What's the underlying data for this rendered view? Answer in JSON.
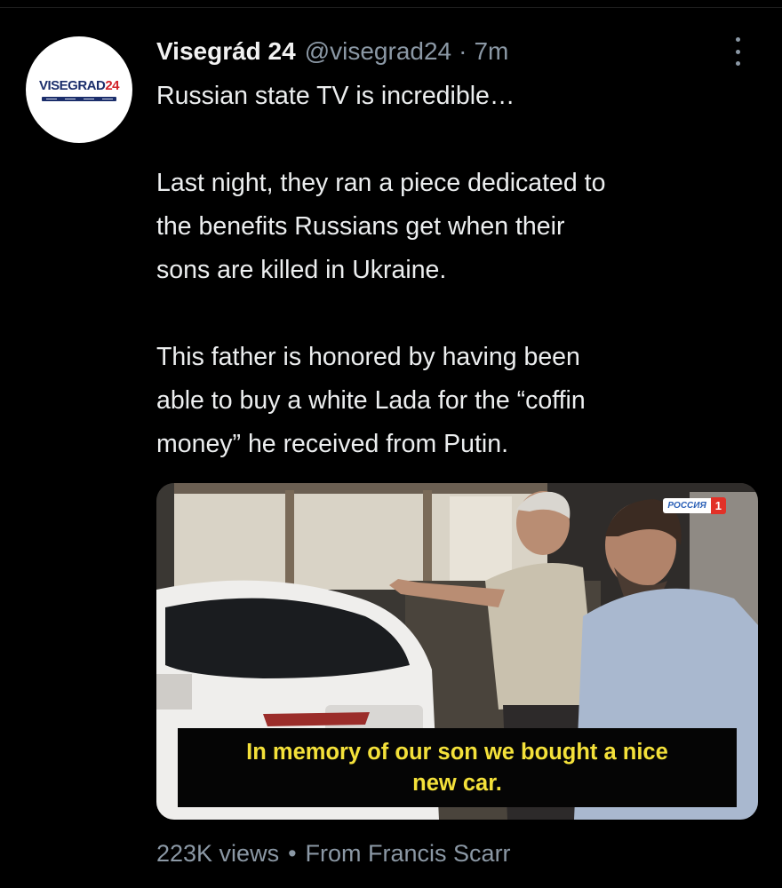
{
  "tweet": {
    "author_name": "Visegrád 24",
    "handle": "@visegrad24",
    "separator": "·",
    "time": "7m",
    "avatar_brand_part1": "VISEGRAD",
    "avatar_brand_part2": "24",
    "text_lines": [
      "Russian state TV is incredible…",
      "Last night, they ran a piece dedicated to",
      "the benefits Russians get when their",
      "sons are killed in Ukraine.",
      "This father is honored by having been",
      "able to buy a white Lada for the “coffin",
      "money” he received from Putin."
    ]
  },
  "media": {
    "channel_logo_text": "РОССИЯ",
    "channel_logo_number": "1",
    "subtitle_line1": "In memory of our son we bought a nice",
    "subtitle_line2": "new car."
  },
  "footer": {
    "views": "223K views",
    "dot": "•",
    "source": "From Francis Scarr"
  }
}
